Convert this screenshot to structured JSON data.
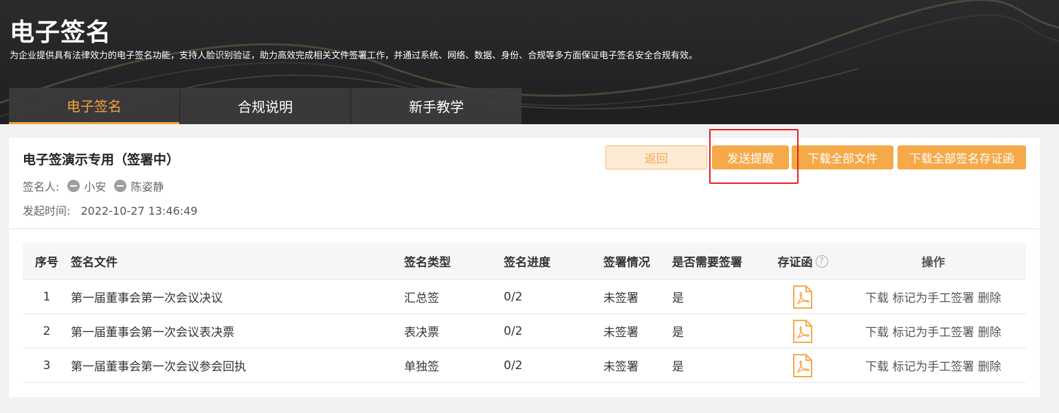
{
  "header": {
    "title": "电子签名",
    "description": "为企业提供具有法律效力的电子签名功能，支持人脸识别验证，助力高效完成相关文件签署工作，并通过系统、网络、数据、身份、合规等多方面保证电子签名安全合规有效。"
  },
  "tabs": [
    {
      "label": "电子签名",
      "active": true
    },
    {
      "label": "合规说明",
      "active": false
    },
    {
      "label": "新手教学",
      "active": false
    }
  ],
  "document": {
    "title": "电子签演示专用（签署中）",
    "signers_label": "签名人:",
    "signers": [
      "小安",
      "陈姿静"
    ],
    "start_time_label": "发起时间:",
    "start_time": "2022-10-27 13:46:49"
  },
  "buttons": {
    "back": "返回",
    "send_reminder": "发送提醒",
    "download_all_files": "下载全部文件",
    "download_all_certs": "下载全部签名存证函"
  },
  "table": {
    "headers": {
      "no": "序号",
      "file": "签名文件",
      "type": "签名类型",
      "progress": "签名进度",
      "status": "签署情况",
      "need_sign": "是否需要签署",
      "cert": "存证函",
      "ops": "操作"
    },
    "help_icon": "?",
    "ops_labels": {
      "download": "下载",
      "mark_manual": "标记为手工签署",
      "delete": "删除"
    },
    "rows": [
      {
        "no": "1",
        "file": "第一届董事会第一次会议决议",
        "type": "汇总签",
        "progress": "0/2",
        "status": "未签署",
        "need_sign": "是"
      },
      {
        "no": "2",
        "file": "第一届董事会第一次会议表决票",
        "type": "表决票",
        "progress": "0/2",
        "status": "未签署",
        "need_sign": "是"
      },
      {
        "no": "3",
        "file": "第一届董事会第一次会议参会回执",
        "type": "单独签",
        "progress": "0/2",
        "status": "未签署",
        "need_sign": "是"
      }
    ]
  },
  "icons": {
    "signer": "minus-circle-icon",
    "cert": "pdf-file-icon",
    "help": "question-circle-icon"
  },
  "colors": {
    "accent": "#f5a949",
    "active_tab": "#f5a23c",
    "highlight_box": "#e02020",
    "header_bg": "#1f1f21"
  }
}
